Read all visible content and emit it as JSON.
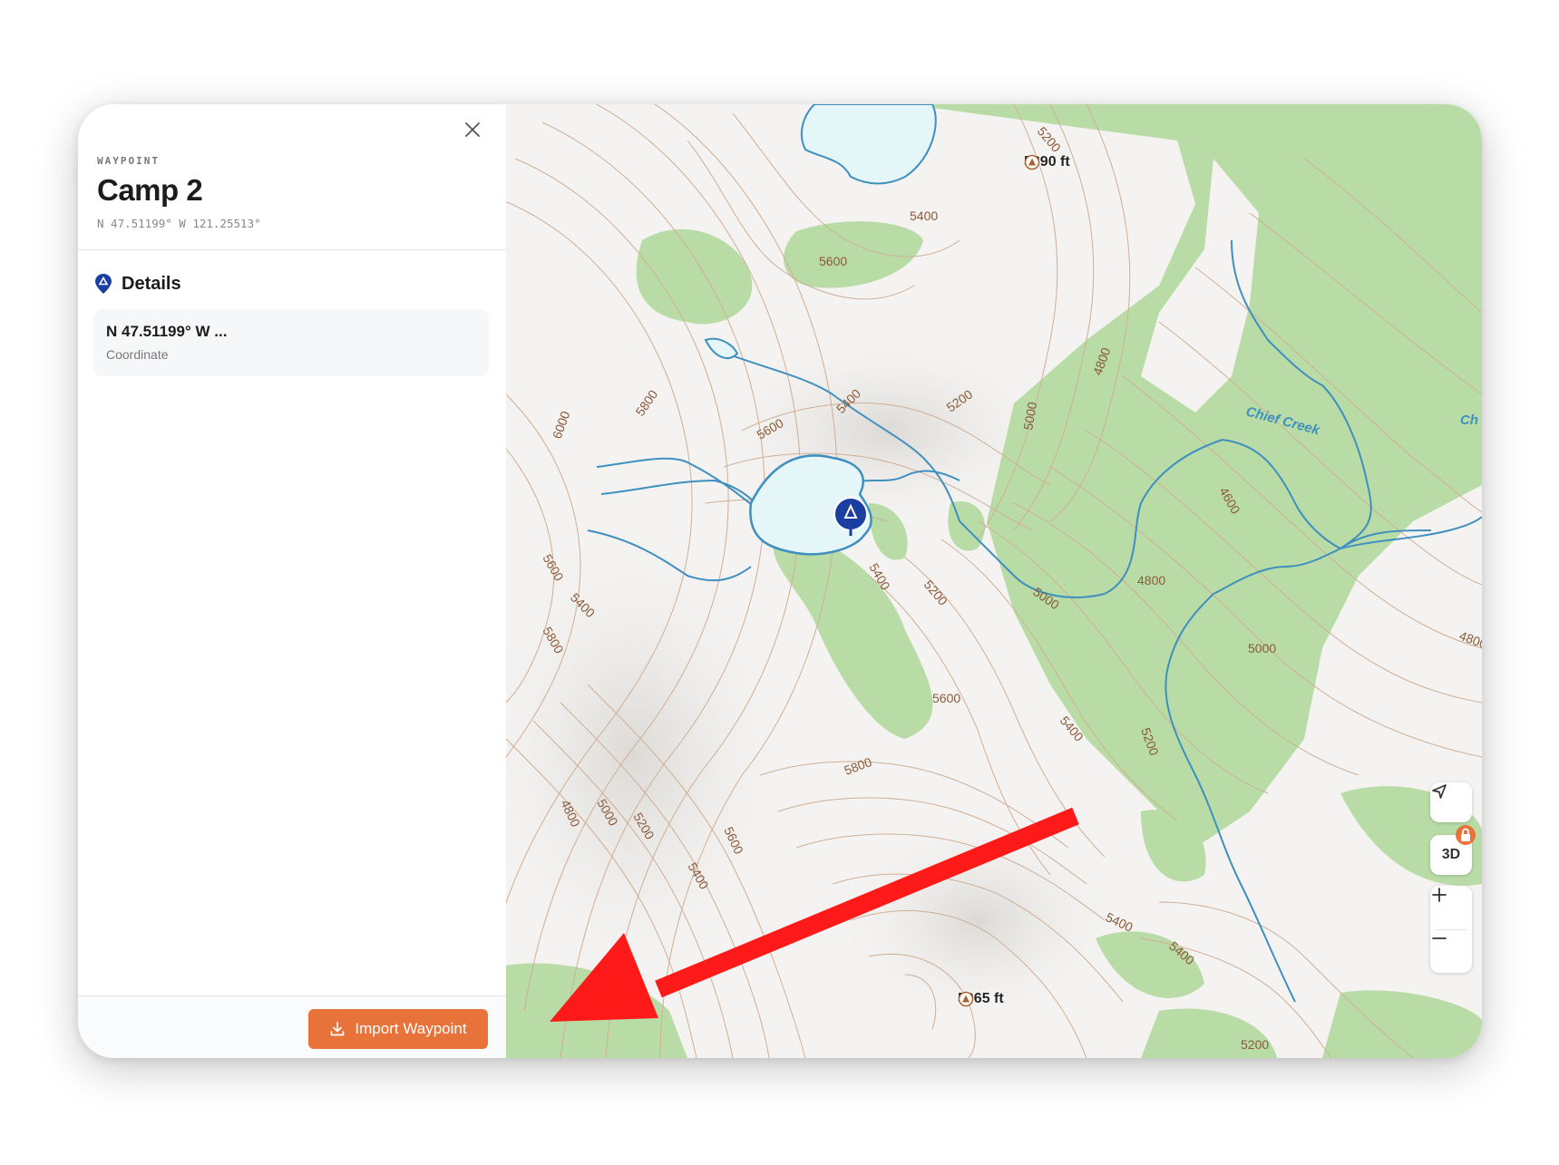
{
  "panel": {
    "kicker": "WAYPOINT",
    "title": "Camp 2",
    "coordinates": "N 47.51199° W 121.25513°",
    "section_title": "Details",
    "detail": {
      "value": "N 47.51199° W ...",
      "label": "Coordinate"
    },
    "import_label": "Import Waypoint"
  },
  "map": {
    "peaks": [
      {
        "label": "5390 ft"
      },
      {
        "label": "5965 ft"
      }
    ],
    "stream_names": [
      "Chief Creek",
      "Ch"
    ],
    "contour_labels": [
      "5200",
      "5400",
      "5600",
      "6000",
      "5800",
      "5600",
      "5400",
      "5200",
      "5000",
      "4800",
      "4600",
      "4800",
      "5000",
      "5400",
      "5200",
      "5000",
      "4800",
      "5600",
      "5400",
      "5200",
      "5800",
      "5600",
      "5400",
      "5800",
      "5600",
      "5400",
      "5400",
      "5200",
      "4800",
      "5000",
      "5200",
      "5400",
      "5600",
      "5600",
      "5400",
      "5600",
      "5000",
      "4800"
    ],
    "controls": {
      "three_d_label": "3D",
      "zoom_in": "+",
      "zoom_out": "−"
    }
  },
  "colors": {
    "accent": "#e8733a",
    "waypoint": "#1a3fa0",
    "water": "#e4f6f8",
    "stream": "#3f8fbf",
    "forest": "#b8dca6",
    "contour": "#c8a78d",
    "annotation_arrow": "#ff0000"
  }
}
